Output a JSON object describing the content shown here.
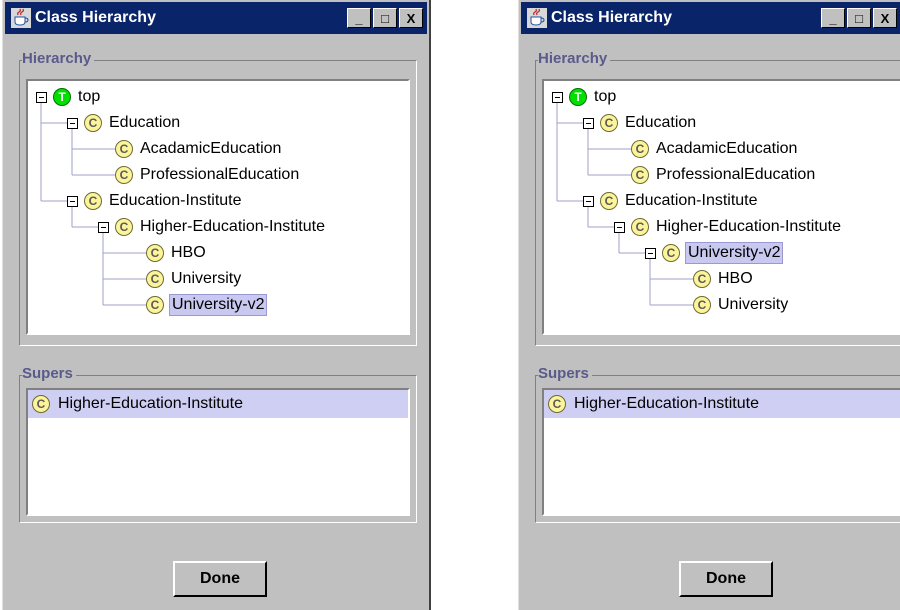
{
  "left_window": {
    "title": "Class Hierarchy",
    "titlebar_buttons": {
      "minimize": "_",
      "maximize": "□",
      "close": "X"
    },
    "hierarchy_title": "Hierarchy",
    "tree": [
      {
        "label": "top",
        "icon": "T",
        "depth": 0,
        "expanded": true,
        "selected": false
      },
      {
        "label": "Education",
        "icon": "C",
        "depth": 1,
        "expanded": true,
        "selected": false
      },
      {
        "label": "AcadamicEducation",
        "icon": "C",
        "depth": 2,
        "expanded": false,
        "selected": false
      },
      {
        "label": "ProfessionalEducation",
        "icon": "C",
        "depth": 2,
        "expanded": false,
        "selected": false
      },
      {
        "label": "Education-Institute",
        "icon": "C",
        "depth": 1,
        "expanded": true,
        "selected": false
      },
      {
        "label": "Higher-Education-Institute",
        "icon": "C",
        "depth": 2,
        "expanded": true,
        "selected": false
      },
      {
        "label": "HBO",
        "icon": "C",
        "depth": 3,
        "expanded": false,
        "selected": false
      },
      {
        "label": "University",
        "icon": "C",
        "depth": 3,
        "expanded": false,
        "selected": false
      },
      {
        "label": "University-v2",
        "icon": "C",
        "depth": 3,
        "expanded": false,
        "selected": true
      }
    ],
    "supers_title": "Supers",
    "supers": [
      {
        "label": "Higher-Education-Institute",
        "icon": "C"
      }
    ],
    "done_label": "Done"
  },
  "right_window": {
    "title": "Class Hierarchy",
    "titlebar_buttons": {
      "minimize": "_",
      "maximize": "□",
      "close": "X"
    },
    "hierarchy_title": "Hierarchy",
    "tree": [
      {
        "label": "top",
        "icon": "T",
        "depth": 0,
        "expanded": true,
        "selected": false
      },
      {
        "label": "Education",
        "icon": "C",
        "depth": 1,
        "expanded": true,
        "selected": false
      },
      {
        "label": "AcadamicEducation",
        "icon": "C",
        "depth": 2,
        "expanded": false,
        "selected": false
      },
      {
        "label": "ProfessionalEducation",
        "icon": "C",
        "depth": 2,
        "expanded": false,
        "selected": false
      },
      {
        "label": "Education-Institute",
        "icon": "C",
        "depth": 1,
        "expanded": true,
        "selected": false
      },
      {
        "label": "Higher-Education-Institute",
        "icon": "C",
        "depth": 2,
        "expanded": true,
        "selected": false
      },
      {
        "label": "University-v2",
        "icon": "C",
        "depth": 3,
        "expanded": true,
        "selected": true
      },
      {
        "label": "HBO",
        "icon": "C",
        "depth": 4,
        "expanded": false,
        "selected": false
      },
      {
        "label": "University",
        "icon": "C",
        "depth": 4,
        "expanded": false,
        "selected": false
      }
    ],
    "supers_title": "Supers",
    "supers": [
      {
        "label": "Higher-Education-Institute",
        "icon": "C"
      }
    ],
    "done_label": "Done"
  },
  "colors": {
    "titlebar": "#0a246a",
    "window_bg": "#c0c0c0",
    "selection_bg": "#c8c8f0",
    "class_icon": "#fbf49a",
    "top_icon": "#00e000",
    "group_title": "#5a5a8c"
  },
  "icons": {
    "app": "java-coffee-cup-icon",
    "class_node": "class-c-icon",
    "top_node": "top-t-icon",
    "expander": "tree-collapse-icon"
  }
}
